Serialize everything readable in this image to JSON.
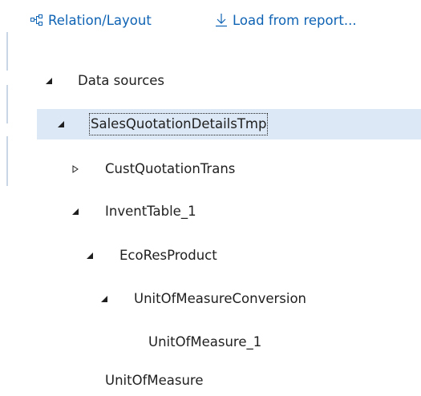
{
  "toolbar": {
    "relation_label": "Relation/Layout",
    "load_label": "Load from report..."
  },
  "tree": {
    "nodes": [
      {
        "label": "Data sources",
        "state": "expanded"
      },
      {
        "label": "SalesQuotationDetailsTmp",
        "state": "expanded",
        "selected": true
      },
      {
        "label": "CustQuotationTrans",
        "state": "collapsed"
      },
      {
        "label": "InventTable_1",
        "state": "expanded"
      },
      {
        "label": "EcoResProduct",
        "state": "expanded"
      },
      {
        "label": "UnitOfMeasureConversion",
        "state": "expanded"
      },
      {
        "label": "UnitOfMeasure_1",
        "state": "leaf"
      },
      {
        "label": "UnitOfMeasure",
        "state": "leaf"
      }
    ]
  },
  "colors": {
    "accent": "#0f63b4",
    "selection": "#dce8f5",
    "leftbar": "#c8d6e5"
  }
}
